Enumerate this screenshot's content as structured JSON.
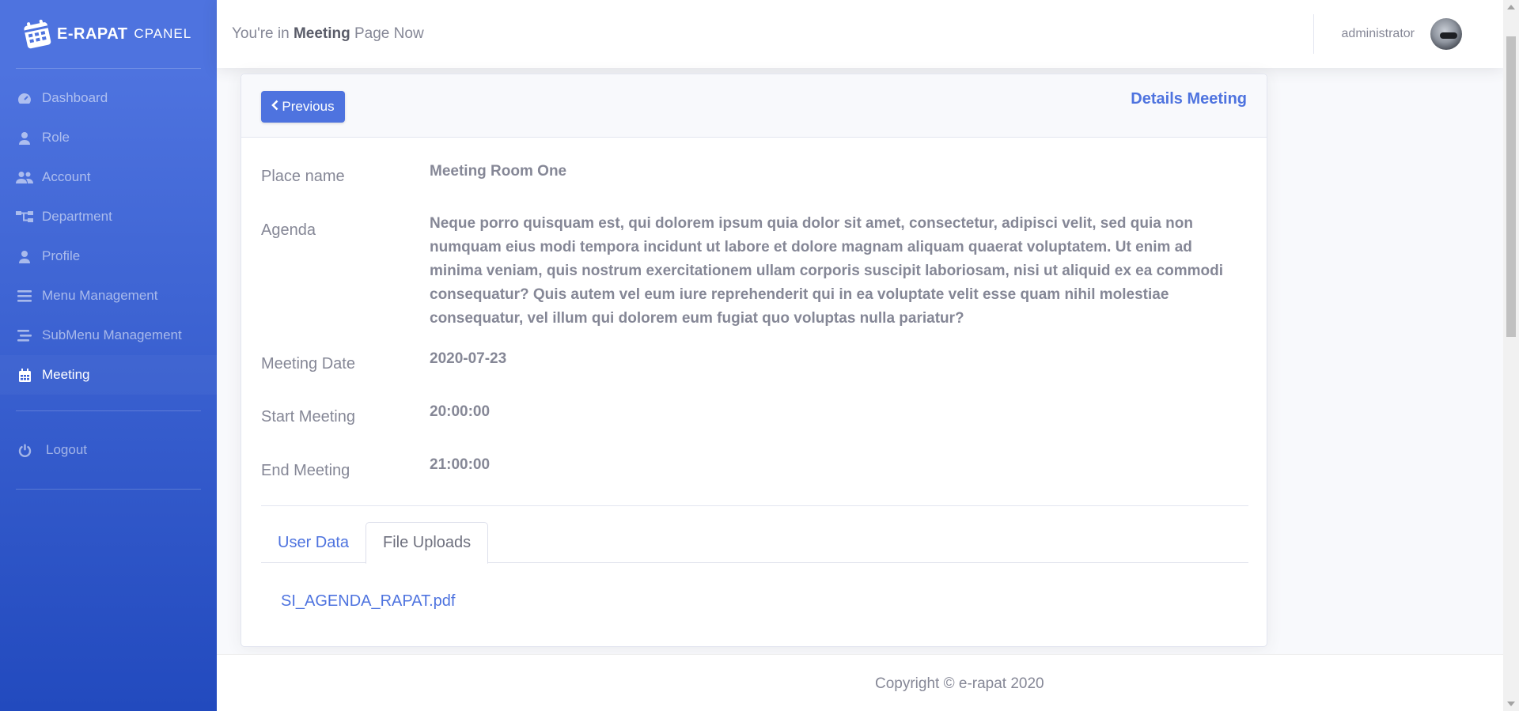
{
  "brand": {
    "name": "E-RAPAT",
    "sub": "CPANEL",
    "icon": "calendar-icon"
  },
  "sidebar": {
    "items": [
      {
        "label": "Dashboard",
        "icon": "tachometer-icon",
        "active": false
      },
      {
        "label": "Role",
        "icon": "user-icon",
        "active": false
      },
      {
        "label": "Account",
        "icon": "users-icon",
        "active": false
      },
      {
        "label": "Department",
        "icon": "sitemap-icon",
        "active": false
      },
      {
        "label": "Profile",
        "icon": "user-icon",
        "active": false
      },
      {
        "label": "Menu Management",
        "icon": "bars-icon",
        "active": false
      },
      {
        "label": "SubMenu Management",
        "icon": "stream-icon",
        "active": false
      },
      {
        "label": "Meeting",
        "icon": "calendar-icon",
        "active": true
      }
    ],
    "logout": {
      "label": "Logout",
      "icon": "power-icon"
    }
  },
  "topbar": {
    "prefix": "You're in ",
    "page": "Meeting",
    "suffix": " Page Now",
    "username": "administrator"
  },
  "card": {
    "previous_label": "Previous",
    "title": "Details Meeting"
  },
  "details": {
    "place": {
      "label": "Place name",
      "value": "Meeting Room One"
    },
    "agenda": {
      "label": "Agenda",
      "value": "Neque porro quisquam est, qui dolorem ipsum quia dolor sit amet, consectetur, adipisci velit, sed quia non numquam eius modi tempora incidunt ut labore et dolore magnam aliquam quaerat voluptatem. Ut enim ad minima veniam, quis nostrum exercitationem ullam corporis suscipit laboriosam, nisi ut aliquid ex ea commodi consequatur? Quis autem vel eum iure reprehenderit qui in ea voluptate velit esse quam nihil molestiae consequatur, vel illum qui dolorem eum fugiat quo voluptas nulla pariatur?"
    },
    "date": {
      "label": "Meeting Date",
      "value": "2020-07-23"
    },
    "start": {
      "label": "Start Meeting",
      "value": "20:00:00"
    },
    "end": {
      "label": "End Meeting",
      "value": "21:00:00"
    }
  },
  "tabs": [
    {
      "label": "User Data",
      "active": false
    },
    {
      "label": "File Uploads",
      "active": true
    }
  ],
  "files": [
    "SI_AGENDA_RAPAT.pdf"
  ],
  "footer": {
    "text": "Copyright © e-rapat 2020"
  },
  "colors": {
    "primary": "#4e73df",
    "sidebar_end": "#224abe",
    "text": "#858796"
  }
}
